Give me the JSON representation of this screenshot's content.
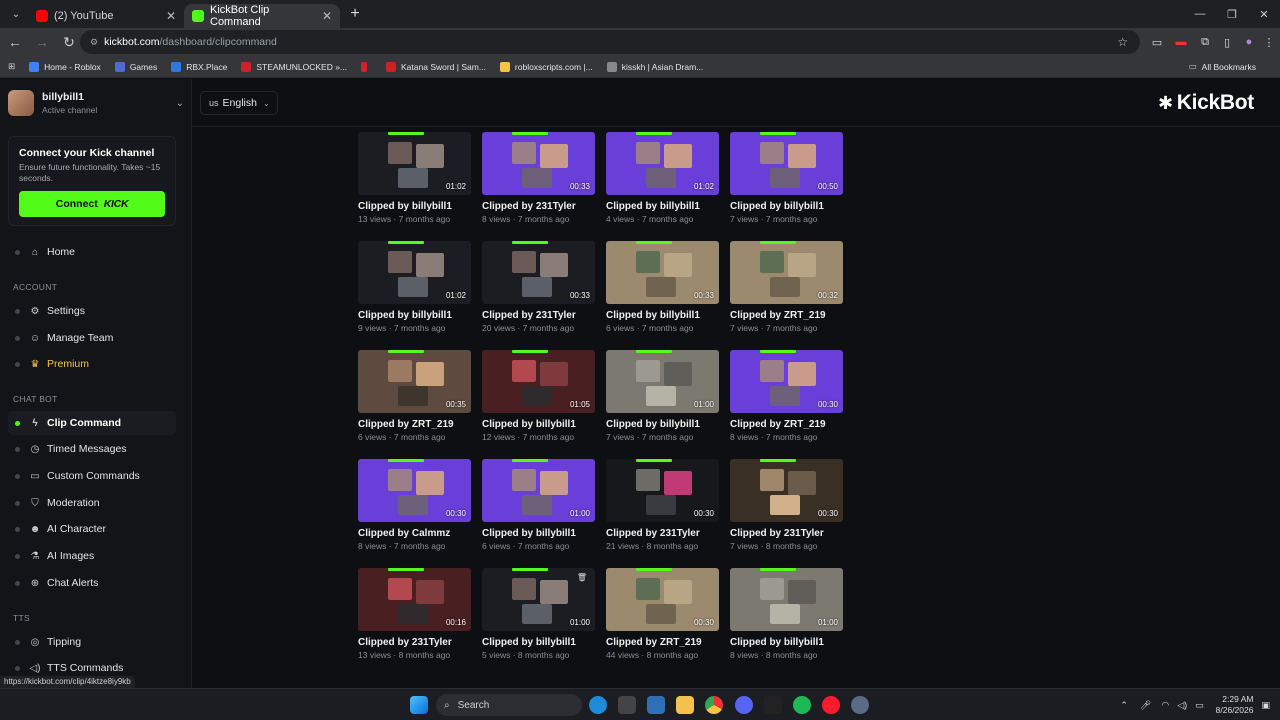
{
  "browser": {
    "tabs": [
      {
        "label": "(2) YouTube",
        "color": "#ff0000",
        "active": false
      },
      {
        "label": "KickBot Clip Command",
        "color": "#53fc18",
        "active": true
      }
    ],
    "url_host": "kickbot.com",
    "url_path": "/dashboard/clipcommand",
    "bookmarks": [
      {
        "label": "Home - Roblox",
        "color": "#3b82f6"
      },
      {
        "label": "Games",
        "color": "#4f6bd6"
      },
      {
        "label": "RBX.Place",
        "color": "#2c7be5"
      },
      {
        "label": "STEAMUNLOCKED »...",
        "color": "#d0202a"
      },
      {
        "label": "",
        "color": "#d0202a"
      },
      {
        "label": "Katana Sword | Sam...",
        "color": "#c22"
      },
      {
        "label": "robloxscripts.com |...",
        "color": "#f5c542"
      },
      {
        "label": "kisskh | Asian Dram...",
        "color": "#888"
      }
    ],
    "all_bookmarks": "All Bookmarks"
  },
  "sidebar": {
    "channel_name": "billybill1",
    "channel_status": "Active channel",
    "connect_title": "Connect your Kick channel",
    "connect_sub": "Ensure future functionality. Takes ~15 seconds.",
    "connect_btn": "Connect",
    "connect_brand": "KICK",
    "sections": {
      "account": "ACCOUNT",
      "chatbot": "CHAT BOT",
      "tts": "TTS"
    },
    "items": {
      "home": "Home",
      "settings": "Settings",
      "manage_team": "Manage Team",
      "premium": "Premium",
      "clip_command": "Clip Command",
      "timed_messages": "Timed Messages",
      "custom_commands": "Custom Commands",
      "moderation": "Moderation",
      "ai_character": "AI Character",
      "ai_images": "AI Images",
      "chat_alerts": "Chat Alerts",
      "tipping": "Tipping",
      "tts_commands": "TTS Commands"
    }
  },
  "header": {
    "lang_code": "us",
    "lang_label": "English",
    "brand": "KickBot"
  },
  "clips": [
    {
      "title": "Clipped by billybill1",
      "meta": "13 views · 7 months ago",
      "duration": "01:02",
      "style": "dark"
    },
    {
      "title": "Clipped by 231Tyler",
      "meta": "8 views · 7 months ago",
      "duration": "00:33",
      "style": "purple"
    },
    {
      "title": "Clipped by billybill1",
      "meta": "4 views · 7 months ago",
      "duration": "01:02",
      "style": "purple"
    },
    {
      "title": "Clipped by billybill1",
      "meta": "7 views · 7 months ago",
      "duration": "00:50",
      "style": "purple"
    },
    {
      "title": "Clipped by billybill1",
      "meta": "9 views · 7 months ago",
      "duration": "01:02",
      "style": "dark"
    },
    {
      "title": "Clipped by 231Tyler",
      "meta": "20 views · 7 months ago",
      "duration": "00:33",
      "style": "dark"
    },
    {
      "title": "Clipped by billybill1",
      "meta": "6 views · 7 months ago",
      "duration": "00:33",
      "style": "game"
    },
    {
      "title": "Clipped by ZRT_219",
      "meta": "7 views · 7 months ago",
      "duration": "00:32",
      "style": "game"
    },
    {
      "title": "Clipped by ZRT_219",
      "meta": "6 views · 7 months ago",
      "duration": "00:35",
      "style": "brown"
    },
    {
      "title": "Clipped by billybill1",
      "meta": "12 views · 7 months ago",
      "duration": "01:05",
      "style": "red"
    },
    {
      "title": "Clipped by billybill1",
      "meta": "7 views · 7 months ago",
      "duration": "01:00",
      "style": "grey"
    },
    {
      "title": "Clipped by ZRT_219",
      "meta": "8 views · 7 months ago",
      "duration": "00:30",
      "style": "purple"
    },
    {
      "title": "Clipped by Calmmz",
      "meta": "8 views · 7 months ago",
      "duration": "00:30",
      "style": "purple"
    },
    {
      "title": "Clipped by billybill1",
      "meta": "6 views · 7 months ago",
      "duration": "01:00",
      "style": "purple"
    },
    {
      "title": "Clipped by 231Tyler",
      "meta": "21 views · 8 months ago",
      "duration": "00:30",
      "style": "umingle"
    },
    {
      "title": "Clipped by 231Tyler",
      "meta": "7 views · 8 months ago",
      "duration": "00:30",
      "style": "room"
    },
    {
      "title": "Clipped by 231Tyler",
      "meta": "13 views · 8 months ago",
      "duration": "00:16",
      "style": "red"
    },
    {
      "title": "Clipped by billybill1",
      "meta": "5 views · 8 months ago",
      "duration": "01:00",
      "style": "dark"
    },
    {
      "title": "Clipped by ZRT_219",
      "meta": "44 views · 8 months ago",
      "duration": "00:30",
      "style": "game"
    },
    {
      "title": "Clipped by billybill1",
      "meta": "8 views · 8 months ago",
      "duration": "01:00",
      "style": "grey"
    }
  ],
  "status_url": "https://kickbot.com/clip/4iktze8iy9kb",
  "taskbar": {
    "search": "Search",
    "time": "2:29 AM",
    "date": "8/26/2026"
  }
}
